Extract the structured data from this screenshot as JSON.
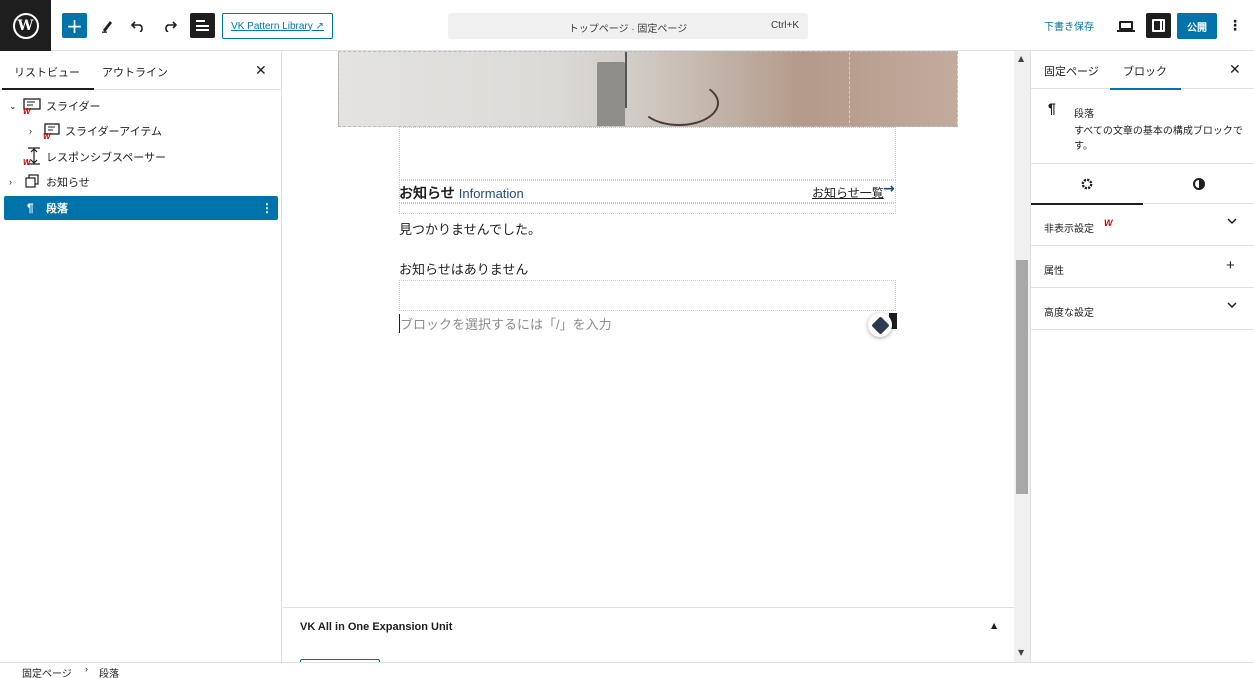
{
  "topbar": {
    "logo": "W",
    "inserter_icon": "+",
    "pattern_library_label": "VK Pattern Library ↗",
    "command_title": "トップページ · 固定ページ",
    "command_shortcut": "Ctrl+K",
    "save_draft_label": "下書き保存",
    "publish_label": "公開",
    "more_icon": "⋮"
  },
  "list_view": {
    "tabs": [
      "リストビュー",
      "アウトライン"
    ],
    "close_icon": "✕",
    "items": [
      {
        "label": "スライダー",
        "icon": "slider-icon",
        "expanded": true
      },
      {
        "label": "スライダーアイテム",
        "icon": "slider-item-icon",
        "expanded": false
      },
      {
        "label": "レスポンシブスペーサー",
        "icon": "spacer-icon"
      },
      {
        "label": "お知らせ",
        "icon": "group-icon",
        "expanded": false
      },
      {
        "label": "段落",
        "icon": "paragraph-icon",
        "selected": true
      }
    ]
  },
  "canvas": {
    "news_heading": "お知らせ",
    "news_heading_en": "Information",
    "news_link": "お知らせ一覧",
    "not_found_text": "見つかりませんでした。",
    "no_news_text": "お知らせはありません",
    "block_placeholder": "ブロックを選択するには「/」を入力"
  },
  "metabox": {
    "title": "VK All in One Expansion Unit"
  },
  "sidebar": {
    "tabs": [
      "固定ページ",
      "ブロック"
    ],
    "active_tab": "ブロック",
    "close_icon": "✕",
    "block_name": "段落",
    "block_description": "すべての文章の基本の構成ブロックです。",
    "panels": [
      {
        "label": "非表示設定",
        "control": "chevron-down-icon"
      },
      {
        "label": "属性",
        "control": "plus-icon"
      },
      {
        "label": "高度な設定",
        "control": "chevron-down-icon"
      }
    ]
  },
  "breadcrumb": [
    "固定ページ",
    "段落"
  ],
  "colors": {
    "accent": "#0073aa",
    "dark": "#1e1e1e",
    "border": "#e0e0e0",
    "vk_red": "#cc0000"
  }
}
